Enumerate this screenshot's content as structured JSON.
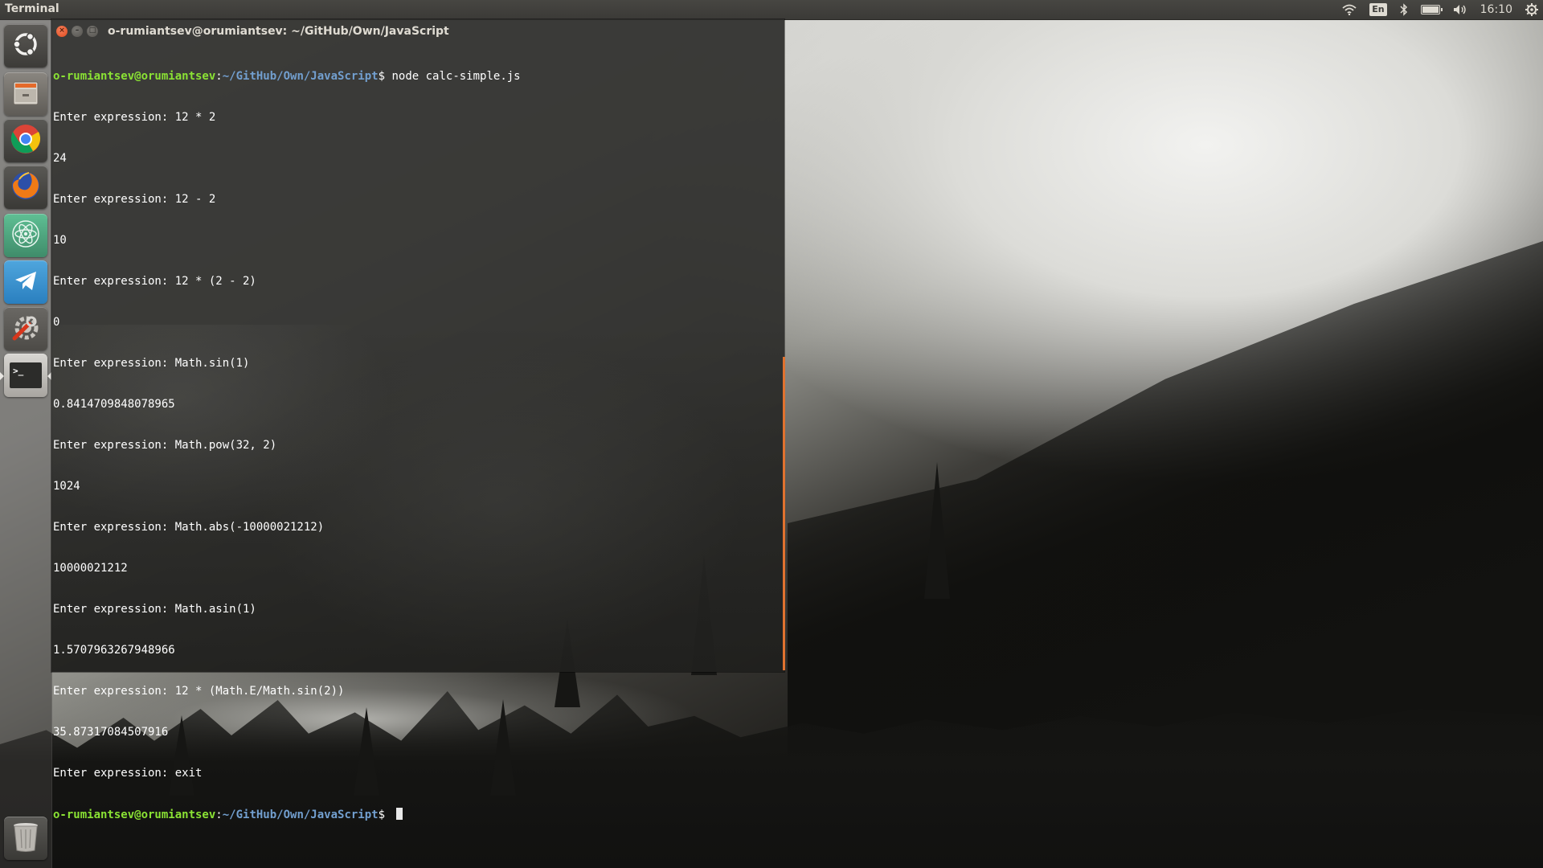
{
  "top_panel": {
    "app_title": "Terminal",
    "keyboard_layout": "En",
    "clock": "16:10",
    "icons": [
      "wifi-icon",
      "keyboard-layout-indicator",
      "bluetooth-icon",
      "battery-icon",
      "volume-icon",
      "clock",
      "system-gear-icon"
    ]
  },
  "launcher": {
    "items": [
      {
        "name": "dash-home",
        "icon": "ubuntu-logo-icon"
      },
      {
        "name": "files",
        "icon": "file-cabinet-icon"
      },
      {
        "name": "chrome",
        "icon": "chrome-icon"
      },
      {
        "name": "firefox",
        "icon": "firefox-icon"
      },
      {
        "name": "atom",
        "icon": "atom-icon"
      },
      {
        "name": "telegram",
        "icon": "telegram-icon"
      },
      {
        "name": "system-settings",
        "icon": "settings-wrench-icon"
      },
      {
        "name": "terminal",
        "icon": "terminal-icon"
      },
      {
        "name": "trash",
        "icon": "trash-icon"
      }
    ],
    "terminal_label": ">_"
  },
  "terminal": {
    "title": "o-rumiantsev@orumiantsev: ~/GitHub/Own/JavaScript",
    "prompt_user": "o-rumiantsev@orumiantsev",
    "prompt_sep": ":",
    "prompt_path": "~/GitHub/Own/JavaScript",
    "prompt_dollar": "$ ",
    "first_command": "node calc-simple.js",
    "output_lines": [
      "Enter expression: 12 * 2",
      "24",
      "Enter expression: 12 - 2",
      "10",
      "Enter expression: 12 * (2 - 2)",
      "0",
      "Enter expression: Math.sin(1)",
      "0.8414709848078965",
      "Enter expression: Math.pow(32, 2)",
      "1024",
      "Enter expression: Math.abs(-10000021212)",
      "10000021212",
      "Enter expression: Math.asin(1)",
      "1.5707963267948966",
      "Enter expression: 12 * (Math.E/Math.sin(2))",
      "35.87317084507916",
      "Enter expression: exit"
    ],
    "close_glyph": "×",
    "minimize_glyph": "–",
    "maximize_glyph": "□"
  }
}
